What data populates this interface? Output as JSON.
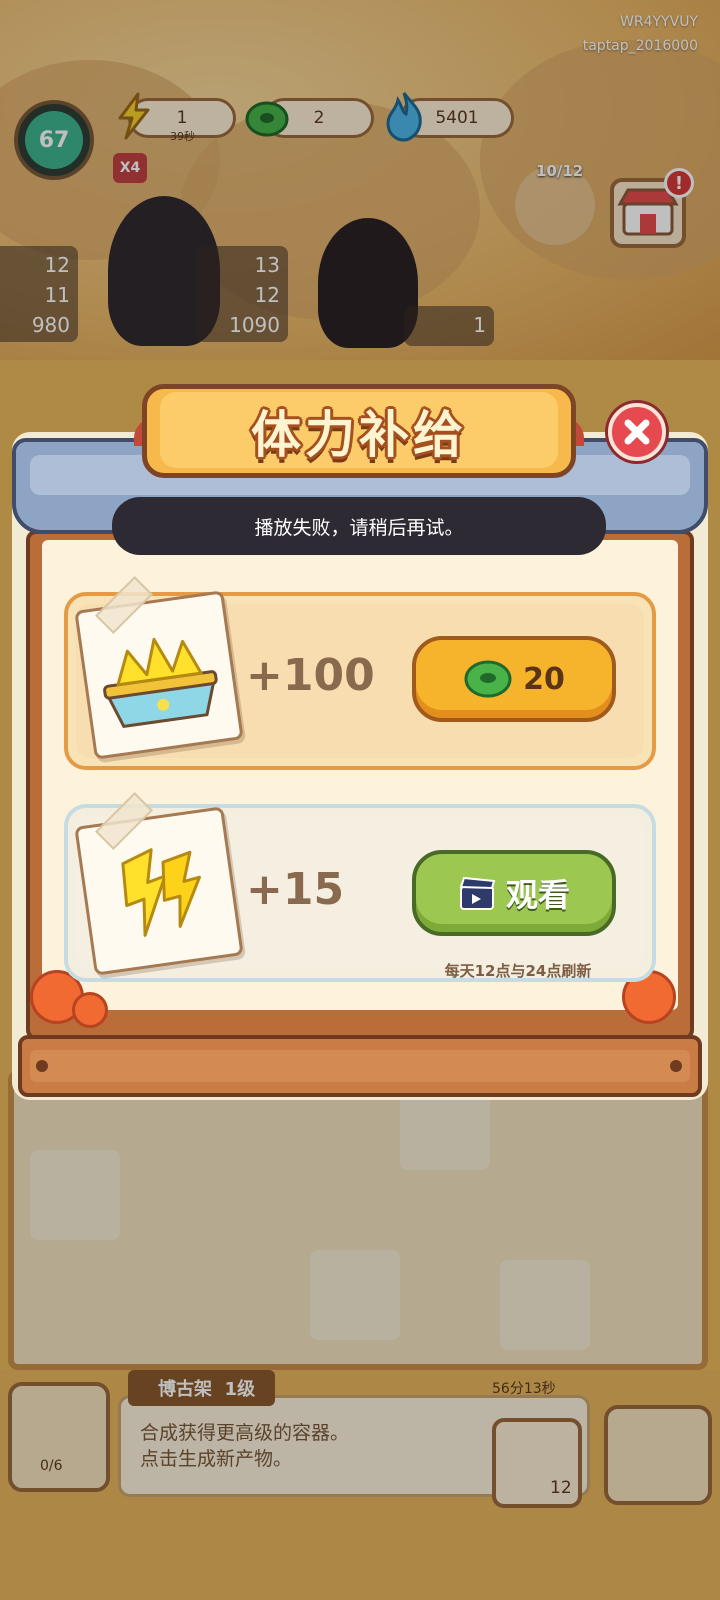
{
  "device": {
    "account_code": "WR4YYVUY",
    "account_name": "taptap_2016000"
  },
  "hud": {
    "level": "67",
    "multiplier": "X4",
    "energy": {
      "value": "1",
      "timer": "39秒"
    },
    "jade_coins": "2",
    "flame_points": "5401",
    "queue": "10/12"
  },
  "characters": [
    {
      "stats": [
        "12",
        "11",
        "980"
      ]
    },
    {
      "stats": [
        "13",
        "12",
        "1090"
      ]
    },
    {
      "stats": [
        "1"
      ]
    }
  ],
  "dialog": {
    "title": "体力补给",
    "toast": "播放失败，请稍后再试。",
    "rows": [
      {
        "amount": "+100",
        "button_price": "20",
        "button_icon": "jade-coin-icon"
      },
      {
        "amount": "+15",
        "button_label": "观看",
        "button_icon": "video-clapper-icon",
        "note": "每天12点与24点刷新"
      }
    ]
  },
  "bottom": {
    "inventory_count": "0/6",
    "item_name": "博古架",
    "item_level": "1级",
    "item_desc_line1": "合成获得更高级的容器。",
    "item_desc_line2": "点击生成新产物。",
    "timer": "56分13秒",
    "coin_count": "12"
  },
  "colors": {
    "title_board": "#f8b94c",
    "buy_button": "#f6b32c",
    "watch_button": "#9cc750",
    "close_button": "#e6494f",
    "toast_bg": "#2d2a33"
  }
}
